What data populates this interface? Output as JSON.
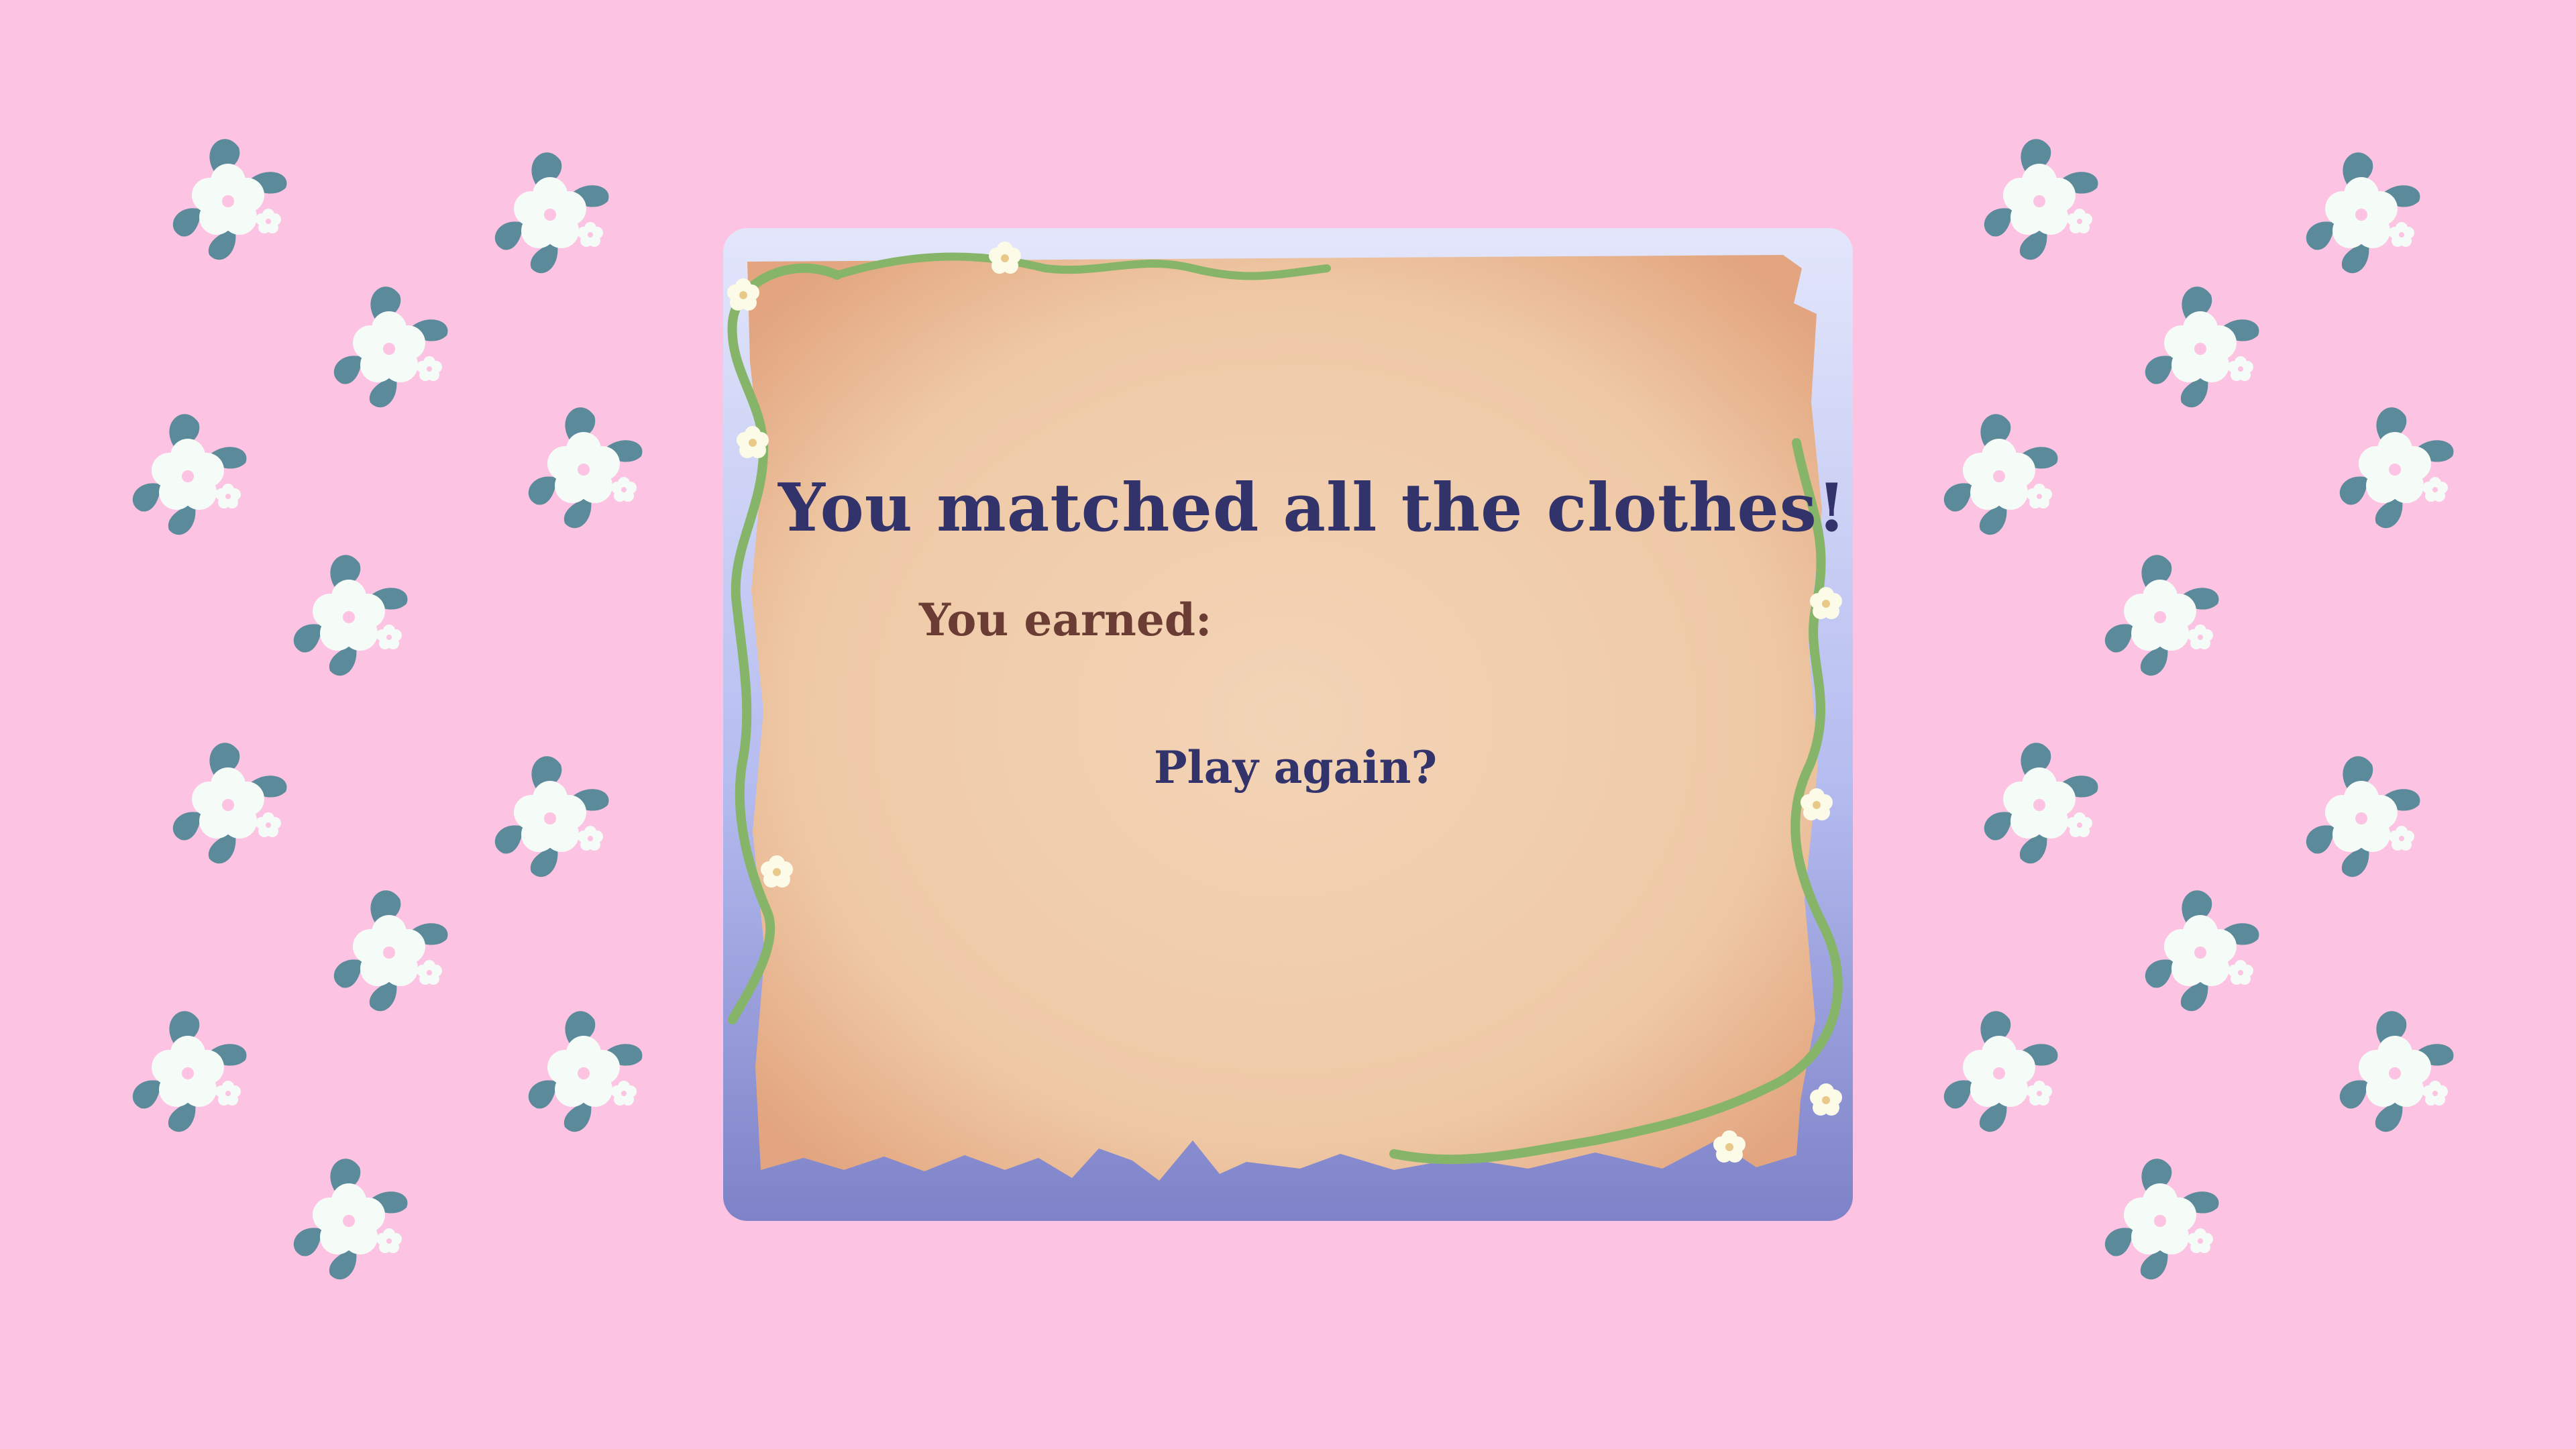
{
  "screen": {
    "title": "You matched all the clothes!",
    "earned_label": "You earned:",
    "play_again_label": "Play again?"
  },
  "colors": {
    "background": "#fcc3e2",
    "title_text": "#33336b",
    "earned_text": "#6a3c34",
    "parchment": "#f2cfae",
    "frame": "#8a8fd0",
    "vine": "#86b56a",
    "flower": "#f5fbf6",
    "leaf": "#5b8a9a"
  },
  "decorations": {
    "background_pattern": "white-flower-icon",
    "panel": "torn-parchment-scroll",
    "border": "green-vine-with-flowers"
  }
}
